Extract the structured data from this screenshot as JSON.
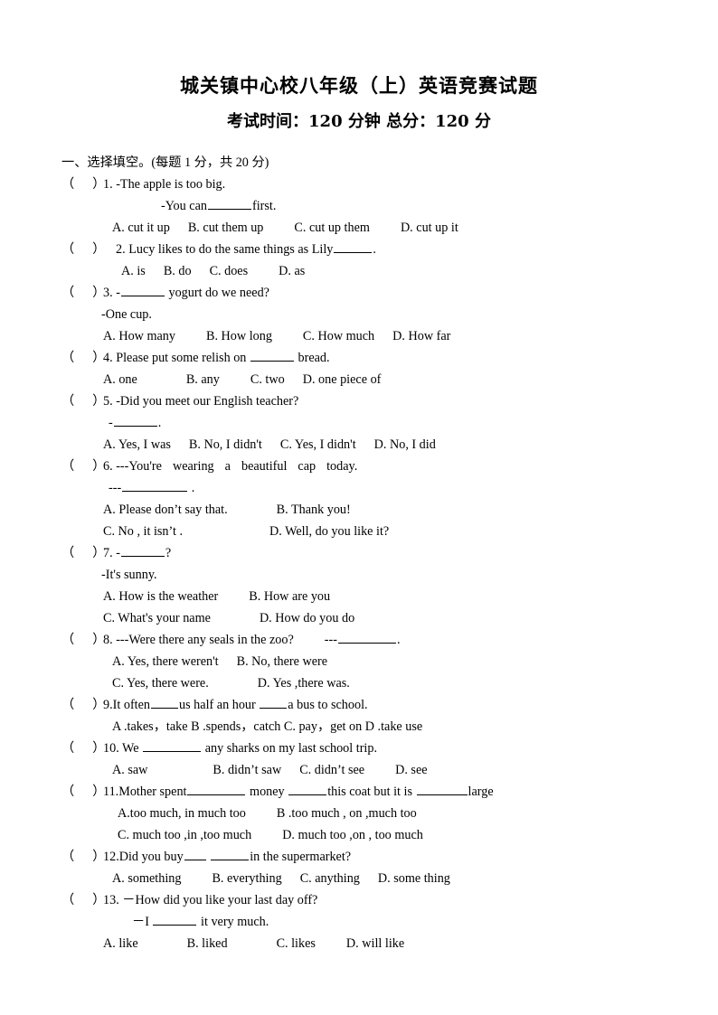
{
  "document": {
    "title": "城关镇中心校八年级（上）英语竞赛试题",
    "subtitle": "考试时间：120 分钟     总分：120 分",
    "exam_time_minutes": "120",
    "total_score": "120"
  },
  "section": {
    "heading": "一、选择填空。(每题 1 分，共 20 分)",
    "points_each": "1",
    "points_total": "20"
  },
  "marker": {
    "left_paren": "（",
    "right_paren": "）"
  },
  "questions": [
    {
      "number": "1.",
      "stem": "-The apple is too big.",
      "stem2_pre": "-You can",
      "stem2_post": "first.",
      "options": [
        "A. cut it up",
        "B. cut them up",
        "C. cut up them",
        "D. cut up it"
      ]
    },
    {
      "number": "2.",
      "stem_pre": "Lucy likes to do the same things as Lily",
      "stem_post": ".",
      "options": [
        "A. is",
        "B.   do",
        "C.   does",
        "D. as"
      ]
    },
    {
      "number": "3.",
      "stem_pre": "-",
      "stem_post": "yogurt do we need?",
      "stem2": "-One cup.",
      "options": [
        "A. How many",
        "B. How long",
        "C. How much",
        "D. How far"
      ]
    },
    {
      "number": "4.",
      "stem_pre": "Please put some relish  on",
      "stem_post": "bread.",
      "options": [
        "A. one",
        "B. any",
        "C. two",
        "D. one piece of"
      ]
    },
    {
      "number": "5.",
      "stem": "-Did you meet our English teacher?",
      "stem2_pre": "-",
      "stem2_post": ".",
      "options": [
        "A. Yes, I was",
        "B. No, I didn't",
        "C. Yes, I didn't",
        "D. No, I did"
      ]
    },
    {
      "number": "6.",
      "stem_words": [
        "---You're",
        "wearing",
        "a",
        "beautiful",
        "cap",
        "today."
      ],
      "stem2_pre": "---",
      "stem2_post": ".",
      "options": [
        "A. Please don’t say that.",
        "B. Thank you!",
        "C. No , it isn’t .",
        "D. Well, do you like it?"
      ]
    },
    {
      "number": "7.",
      "stem_pre": "-",
      "stem_post": "?",
      "stem2": "-It's sunny.",
      "options": [
        "A. How is the weather",
        "B. How are you",
        "C. What's your name",
        "D. How do you do"
      ]
    },
    {
      "number": "8.",
      "stem": "---Were there any seals in the zoo?",
      "stem_tail_pre": "---",
      "stem_tail_post": ".",
      "options": [
        "A. Yes, there weren't",
        "B. No, there were",
        "C. Yes, there were.",
        "D. Yes ,there was."
      ]
    },
    {
      "number": "9.",
      "stem_a": "It often",
      "stem_b": "us half an hour",
      "stem_c": "a bus to school.",
      "options_line": "A .takes，take  B   .spends，catch    C. pay，get on D .take use"
    },
    {
      "number": "10.",
      "stem_pre": "We",
      "stem_post": "any sharks on my last school trip.",
      "options": [
        "A. saw",
        "B. didn’t saw",
        "C. didn’t see",
        "D. see"
      ]
    },
    {
      "number": "11.",
      "stem_a": "Mother spent",
      "stem_b": "money",
      "stem_c": "this coat but it is",
      "stem_d": "large",
      "options": [
        "A.too much, in much too",
        "B .too much , on ,much too",
        "C. much too ,in ,too much",
        "D. much too ,on , too much"
      ]
    },
    {
      "number": "12.",
      "stem_a": "Did you buy",
      "stem_b": "in the supermarket?",
      "options": [
        "A. something",
        "B. everything",
        "C. anything",
        "D. some thing"
      ]
    },
    {
      "number": "13.",
      "stem": "－How did you like your last day off?",
      "stem2_pre": "－I",
      "stem2_post": "it very much.",
      "options": [
        "A. like",
        "B. liked",
        "C. likes",
        "D. will like"
      ]
    }
  ]
}
